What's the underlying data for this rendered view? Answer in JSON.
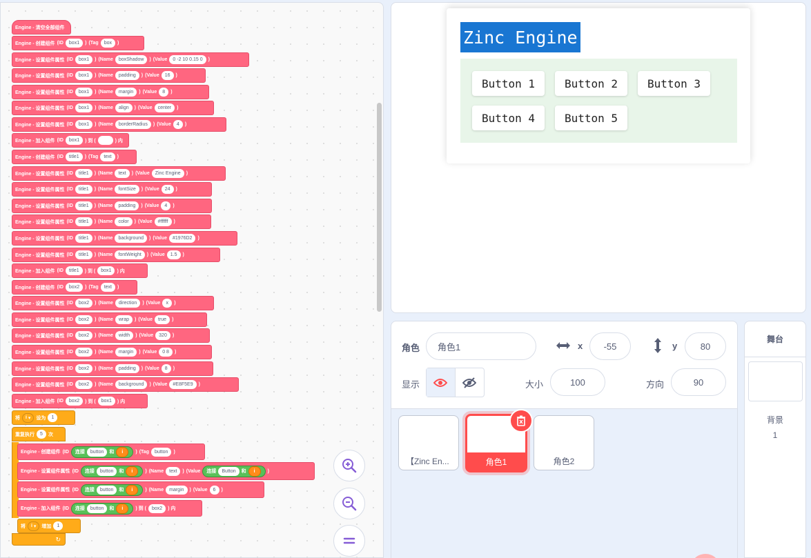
{
  "blocks": {
    "clear": "Engine - 清空全部组件",
    "create": "Engine - 创建组件",
    "set": "Engine - 设置组件属性",
    "append": "Engine - 加入组件",
    "id": "(ID",
    "tag": "(Tag",
    "name": "(Name",
    "value": "(Value",
    "close": ")",
    "to": ") 到 (",
    "in": ") 内",
    "join": "连接",
    "and": "和",
    "set_var": "将",
    "set_to": "设为",
    "repeat": "重复执行",
    "times": "次",
    "increase": "增加",
    "var_name": "i",
    "repeat_icon": "↻",
    "args": {
      "b1": "box1",
      "box": "box",
      "boxShadow": "boxShadow",
      "shadow_val": "0 -2 10 0.15 0",
      "padding": "padding",
      "v16": "16",
      "margin": "margin",
      "v8": "8",
      "align": "align",
      "center": "center",
      "borderRadius": "borderRadius",
      "v4": "4",
      "t1": "title1",
      "text": "text",
      "zinc": "Zinc Engine",
      "fontSize": "fontSize",
      "v24": "24",
      "color": "color",
      "white": "#ffffff",
      "background": "background",
      "blue": "#1976D2",
      "fontWeight": "fontWeight",
      "v15": "1.5",
      "b2": "box2",
      "direction": "direction",
      "x": "x",
      "wrap": "wrap",
      "true": "true",
      "width": "width",
      "v320": "320",
      "v08": "0 8",
      "green": "#E8F5E9",
      "v1": "1",
      "v5": "5",
      "button": "button",
      "Button": "Button",
      "v6": "6"
    }
  },
  "stage": {
    "title": "Zinc Engine",
    "buttons": [
      "Button 1",
      "Button 2",
      "Button 3",
      "Button 4",
      "Button 5"
    ]
  },
  "sprite_info": {
    "sprite_label": "角色",
    "sprite_name": "角色1",
    "x_label": "x",
    "x_value": "-55",
    "y_label": "y",
    "y_value": "80",
    "show_label": "显示",
    "size_label": "大小",
    "size_value": "100",
    "direction_label": "方向",
    "direction_value": "90"
  },
  "sprites": [
    {
      "name": "【Zinc En..."
    },
    {
      "name": "角色1"
    },
    {
      "name": "角色2"
    }
  ],
  "stage_panel": {
    "title": "舞台",
    "backdrop_label": "背景",
    "backdrop_count": "1"
  }
}
